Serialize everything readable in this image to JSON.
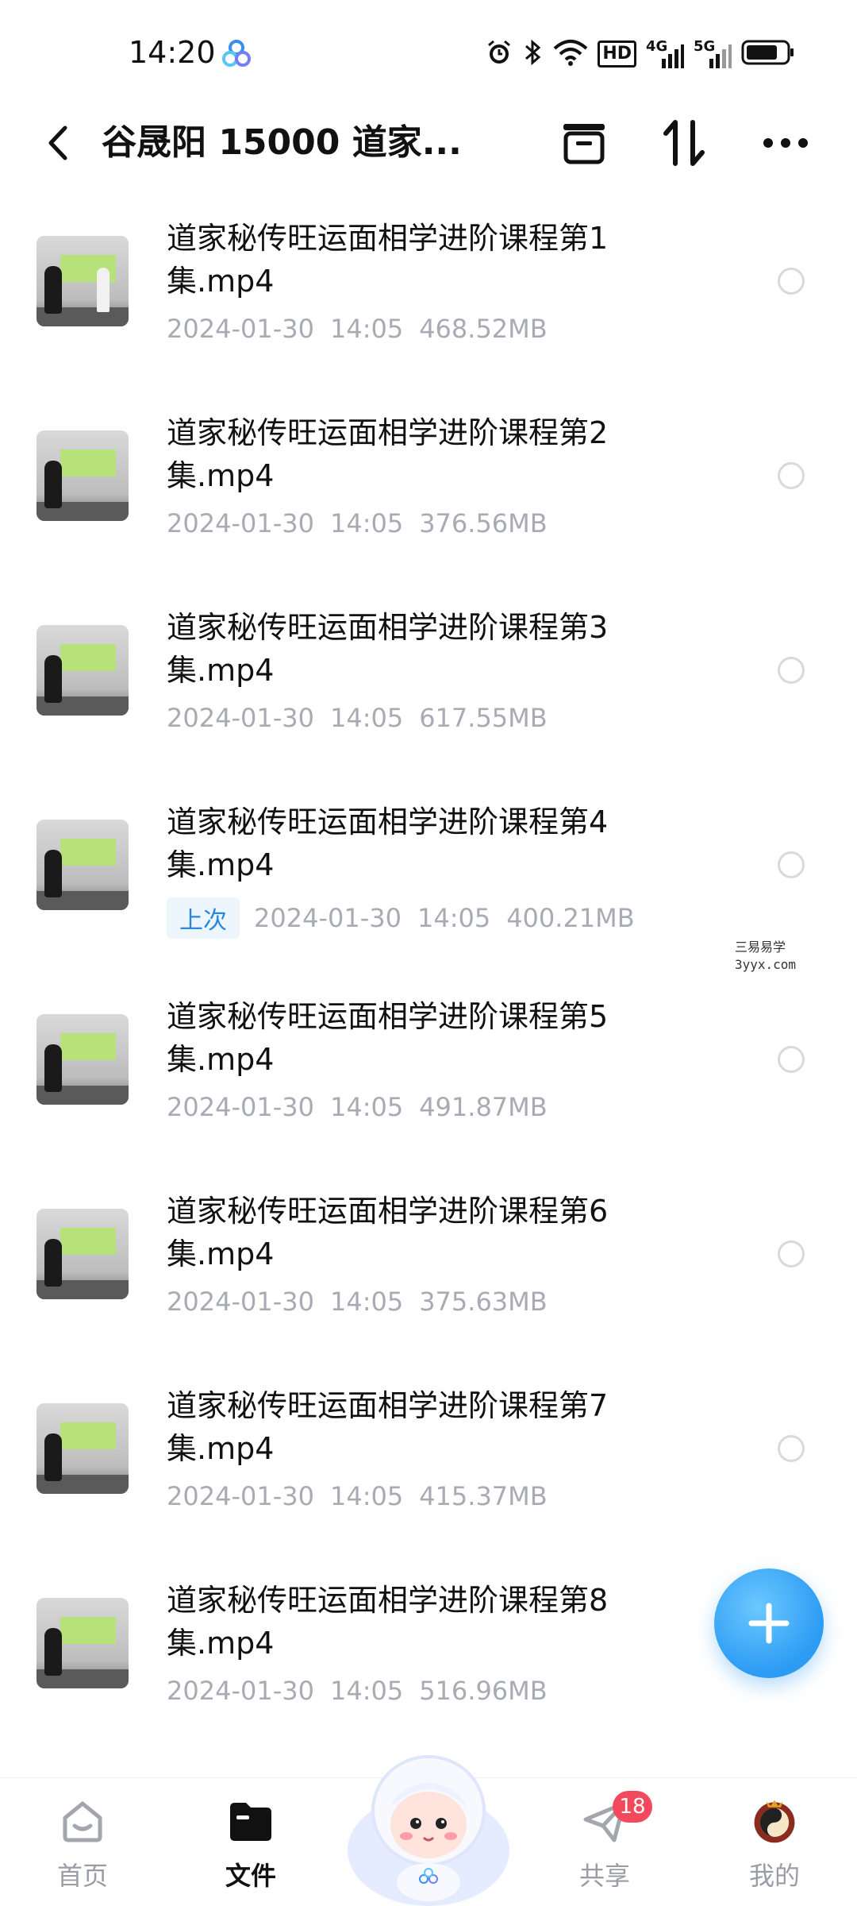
{
  "status_bar": {
    "time": "14:20",
    "icons": [
      "app-logo-icon",
      "alarm-icon",
      "bluetooth-icon",
      "wifi-icon",
      "hd-icon",
      "4g-signal-icon",
      "5g-signal-icon",
      "battery-icon"
    ],
    "hd_text": "HD",
    "net1": "4G",
    "net2": "5G"
  },
  "header": {
    "title": "谷晟阳 15000 道家...",
    "back_icon": "chevron-left-icon",
    "action_icons": [
      "archive-box-icon",
      "sort-icon",
      "more-icon"
    ]
  },
  "files": [
    {
      "name": "道家秘传旺运面相学进阶课程第1集.mp4",
      "date": "2024-01-30",
      "time": "14:05",
      "size": "468.52MB",
      "badge": ""
    },
    {
      "name": "道家秘传旺运面相学进阶课程第2集.mp4",
      "date": "2024-01-30",
      "time": "14:05",
      "size": "376.56MB",
      "badge": ""
    },
    {
      "name": "道家秘传旺运面相学进阶课程第3集.mp4",
      "date": "2024-01-30",
      "time": "14:05",
      "size": "617.55MB",
      "badge": ""
    },
    {
      "name": "道家秘传旺运面相学进阶课程第4集.mp4",
      "date": "2024-01-30",
      "time": "14:05",
      "size": "400.21MB",
      "badge": "上次"
    },
    {
      "name": "道家秘传旺运面相学进阶课程第5集.mp4",
      "date": "2024-01-30",
      "time": "14:05",
      "size": "491.87MB",
      "badge": ""
    },
    {
      "name": "道家秘传旺运面相学进阶课程第6集.mp4",
      "date": "2024-01-30",
      "time": "14:05",
      "size": "375.63MB",
      "badge": ""
    },
    {
      "name": "道家秘传旺运面相学进阶课程第7集.mp4",
      "date": "2024-01-30",
      "time": "14:05",
      "size": "415.37MB",
      "badge": ""
    },
    {
      "name": "道家秘传旺运面相学进阶课程第8集.mp4",
      "date": "2024-01-30",
      "time": "14:05",
      "size": "516.96MB",
      "badge": ""
    }
  ],
  "watermark": {
    "line1": "三易易学",
    "line2": "3yyx.com"
  },
  "fab": {
    "icon": "plus-icon"
  },
  "bottom_nav": {
    "items": [
      {
        "label": "首页",
        "icon": "home-icon",
        "active": false
      },
      {
        "label": "文件",
        "icon": "folder-icon",
        "active": true
      },
      {
        "label": "共享",
        "icon": "paper-plane-icon",
        "active": false,
        "badge": "18"
      },
      {
        "label": "我的",
        "icon": "avatar-icon",
        "active": false
      }
    ],
    "center_icon": "mascot-icon"
  },
  "colors": {
    "accent": "#2b9bf4",
    "badge_red": "#f24a5c",
    "meta_gray": "#a8abb3",
    "last_badge_text": "#2a86e0",
    "last_badge_bg": "#edf5fd"
  }
}
